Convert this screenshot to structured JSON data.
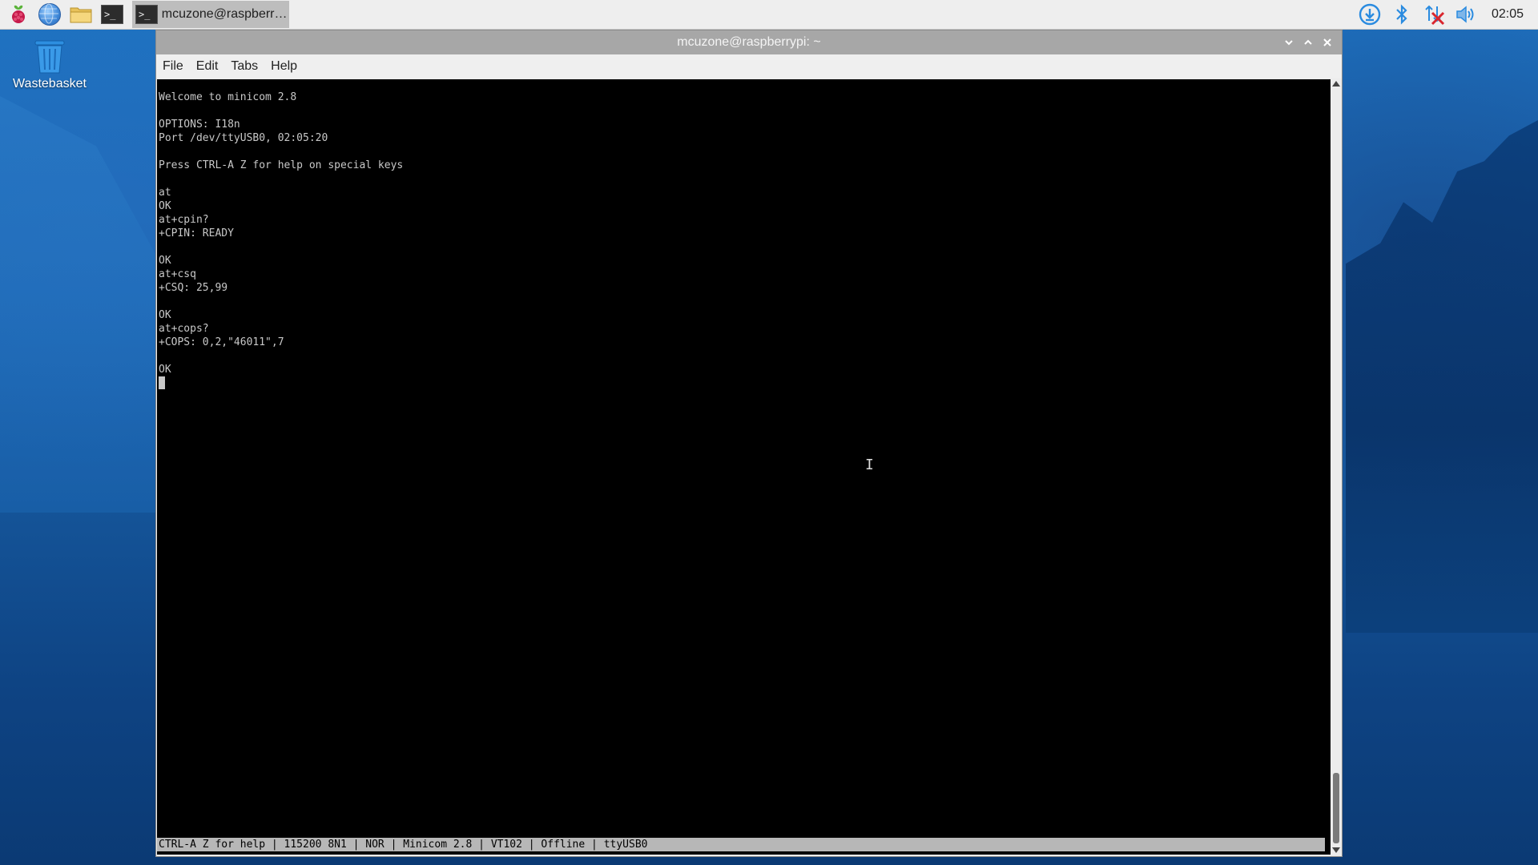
{
  "taskbar": {
    "task_button_label": "mcuzone@raspberry...",
    "clock": "02:05",
    "icons": {
      "menu": "raspberry-pi-icon",
      "browser": "globe-icon",
      "files": "folder-icon",
      "terminal": "terminal-icon",
      "updates": "download-icon",
      "bluetooth": "bluetooth-icon",
      "network": "network-disconnected-icon",
      "volume": "volume-icon"
    }
  },
  "desktop": {
    "wastebasket_label": "Wastebasket"
  },
  "window": {
    "title": "mcuzone@raspberrypi: ~",
    "menu": [
      "File",
      "Edit",
      "Tabs",
      "Help"
    ],
    "terminal_lines": [
      "Welcome to minicom 2.8",
      "",
      "OPTIONS: I18n",
      "Port /dev/ttyUSB0, 02:05:20",
      "",
      "Press CTRL-A Z for help on special keys",
      "",
      "at",
      "OK",
      "at+cpin?",
      "+CPIN: READY",
      "",
      "OK",
      "at+csq",
      "+CSQ: 25,99",
      "",
      "OK",
      "at+cops?",
      "+COPS: 0,2,\"46011\",7",
      "",
      "OK"
    ],
    "status_line": "CTRL-A Z for help | 115200 8N1 | NOR | Minicom 2.8 | VT102 | Offline | ttyUSB0"
  },
  "colors": {
    "taskbar_bg": "#eeeeee",
    "titlebar_bg": "#a7a7a7",
    "terminal_bg": "#000000",
    "terminal_fg": "#c8c8c8",
    "statusbar_bg": "#b7b7b7",
    "accent_blue": "#1f73c2",
    "network_red": "#d9262e"
  }
}
